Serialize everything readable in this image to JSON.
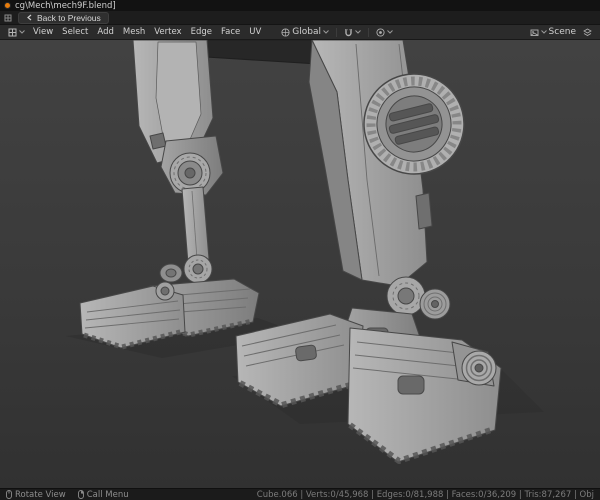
{
  "window": {
    "title": "cg\\Mech\\mech9F.blend]"
  },
  "topbar": {
    "back_label": "Back to Previous"
  },
  "header": {
    "menus": [
      "View",
      "Select",
      "Add",
      "Mesh",
      "Vertex",
      "Edge",
      "Face",
      "UV"
    ],
    "orientation": "Global",
    "scene_name": "Scene"
  },
  "statusbar": {
    "hint_rotate": "Rotate View",
    "hint_menu": "Call Menu",
    "stats_text": "Cube.066  |  Verts:0/45,968 | Edges:0/81,988 | Faces:0/36,209 | Tris:87,267 | Obj"
  },
  "colors": {
    "viewport_bg": "#3a3a3a",
    "model_gray": "#a4a4a4",
    "wire_edge": "#474747",
    "blender_accent": "#e87d0d"
  }
}
